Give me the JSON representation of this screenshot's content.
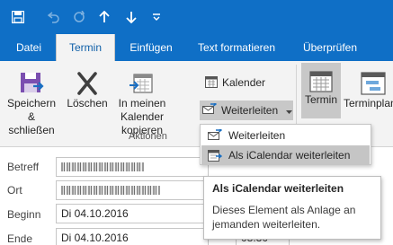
{
  "colors": {
    "accent": "#0f6fc6",
    "ribbon_bg": "#f3f3f3",
    "menu_hover": "#c5c5c5"
  },
  "quick_access": {
    "save_icon": "save-icon",
    "undo_icon": "undo-icon",
    "redo_icon": "redo-icon",
    "up_icon": "arrow-up-icon",
    "down_icon": "arrow-down-icon",
    "customize_icon": "chevron-down-icon"
  },
  "tabs": [
    {
      "label": "Datei"
    },
    {
      "label": "Termin",
      "active": true
    },
    {
      "label": "Einfügen"
    },
    {
      "label": "Text formatieren"
    },
    {
      "label": "Überprüfen"
    }
  ],
  "ribbon": {
    "save_close": {
      "line1": "Speichern",
      "line2": "& schließen"
    },
    "delete": {
      "label": "Löschen"
    },
    "copy_to_calendar": {
      "line1": "In meinen",
      "line2": "Kalender kopieren"
    },
    "calendar": {
      "label": "Kalender"
    },
    "forward": {
      "label": "Weiterleiten"
    },
    "actions_group": {
      "label": "Aktionen"
    },
    "appointment": {
      "label": "Termin"
    },
    "scheduling": {
      "label": "Terminplan"
    }
  },
  "form": {
    "subject_label": "Betreff",
    "location_label": "Ort",
    "start_label": "Beginn",
    "start_date": "Di 04.10.2016",
    "end_label": "Ende",
    "end_date": "Di 04.10.2016",
    "end_time": "08:30"
  },
  "forward_menu": {
    "items": [
      {
        "label": "Weiterleiten",
        "icon": "forward-mail-icon"
      },
      {
        "label": "Als iCalendar weiterleiten",
        "icon": "icalendar-icon",
        "hovered": true
      }
    ]
  },
  "tooltip": {
    "title": "Als iCalendar weiterleiten",
    "description": "Dieses Element als Anlage an jemanden weiterleiten."
  }
}
